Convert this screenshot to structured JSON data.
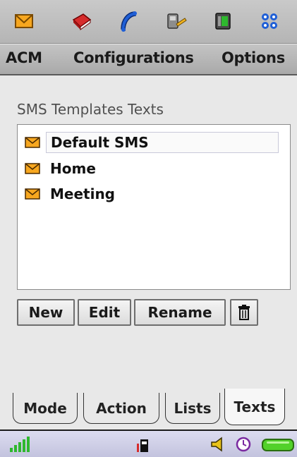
{
  "toolbar": {
    "icons": [
      "mail-icon",
      "book-icon",
      "phone-handset-icon",
      "tools-icon",
      "sim-card-icon",
      "apps-grid-icon"
    ]
  },
  "menu": {
    "items": [
      "ACM",
      "Configurations",
      "Options"
    ]
  },
  "section": {
    "title": "SMS Templates Texts"
  },
  "templates": {
    "items": [
      {
        "label": "Default SMS",
        "selected": true
      },
      {
        "label": "Home",
        "selected": false
      },
      {
        "label": "Meeting",
        "selected": false
      }
    ]
  },
  "actions": {
    "new_label": "New",
    "edit_label": "Edit",
    "rename_label": "Rename",
    "delete_icon": "trash-icon"
  },
  "tabs": {
    "items": [
      "Mode",
      "Action",
      "Lists",
      "Texts"
    ],
    "active": "Texts"
  },
  "status": {
    "icons": [
      "signal-strength-icon",
      "phone-memory-icon",
      "speaker-icon",
      "alarm-clock-icon",
      "battery-icon"
    ]
  },
  "colors": {
    "envelope": "#f7a71f",
    "book": "#d62c2c",
    "phone": "#1f5fd6",
    "signal": "#2eb82e",
    "battery": "#52d12a"
  }
}
